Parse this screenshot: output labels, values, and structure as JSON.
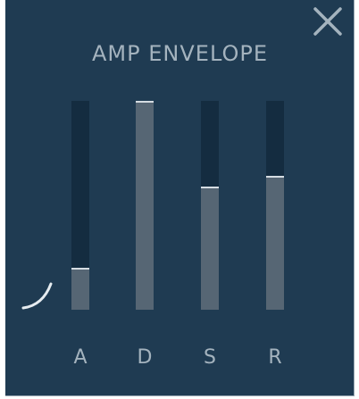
{
  "title": "AMP ENVELOPE",
  "icons": {
    "close": "close-icon",
    "curve": "curve-icon"
  },
  "colors": {
    "panel_bg": "#1f3b52",
    "track": "#142c40",
    "fill": "#566674",
    "handle": "#d5dce2",
    "text": "#a4b3be"
  },
  "sliders": [
    {
      "label": "A",
      "value": 0.2
    },
    {
      "label": "D",
      "value": 1.0
    },
    {
      "label": "S",
      "value": 0.59
    },
    {
      "label": "R",
      "value": 0.64
    }
  ]
}
